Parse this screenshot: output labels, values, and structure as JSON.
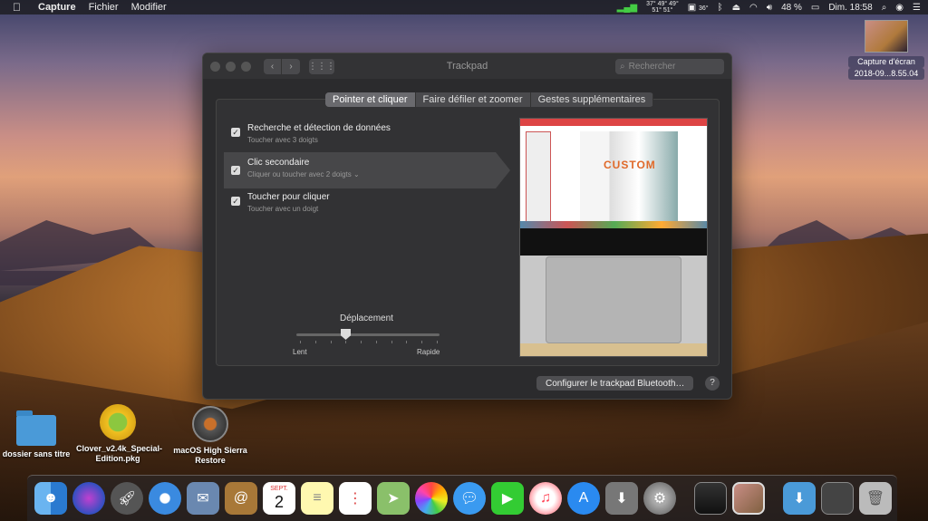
{
  "menubar": {
    "app": "Capture",
    "items": [
      "Fichier",
      "Modifier"
    ],
    "temps_top": "37° 49° 49°",
    "temps_bottom": "51° 51°",
    "temp2": "36°",
    "battery": "48 %",
    "clock": "Dim. 18:58"
  },
  "desktop_screenshot": {
    "label1": "Capture d'écran",
    "label2": "2018-09...8.55.04"
  },
  "window": {
    "title": "Trackpad",
    "search_placeholder": "Rechercher",
    "tabs": [
      "Pointer et cliquer",
      "Faire défiler et zoomer",
      "Gestes supplémentaires"
    ],
    "options": [
      {
        "title": "Recherche et détection de données",
        "sub": "Toucher avec 3 doigts",
        "checked": true
      },
      {
        "title": "Clic secondaire",
        "sub": "Cliquer ou toucher avec 2 doigts ⌄",
        "checked": true
      },
      {
        "title": "Toucher pour cliquer",
        "sub": "Toucher avec un doigt",
        "checked": true
      }
    ],
    "slider": {
      "label": "Déplacement",
      "min": "Lent",
      "max": "Rapide"
    },
    "preview_text": "CUSTOM",
    "configure_button": "Configurer le trackpad Bluetooth…",
    "help": "?"
  },
  "desktop_files": [
    {
      "name": "dossier sans titre"
    },
    {
      "name": "Clover_v2.4k_Special-Edition.pkg"
    },
    {
      "name": "macOS High Sierra Restore"
    }
  ],
  "dock": {
    "calendar_month": "SEPT.",
    "calendar_day": "2"
  }
}
